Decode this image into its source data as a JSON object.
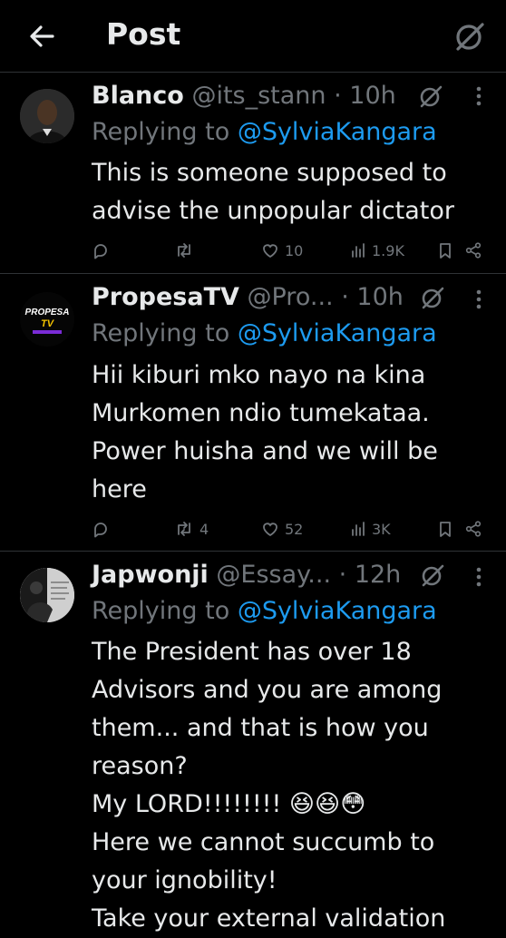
{
  "header": {
    "title": "Post",
    "back_icon": "arrow-left-icon",
    "grok_icon": "grok-icon"
  },
  "colors": {
    "background": "#000000",
    "text": "#e7e9ea",
    "muted": "#71767b",
    "link": "#1d9bf0",
    "divider": "#2f3336"
  },
  "posts": [
    {
      "name": "Blanco",
      "handle": "@its_stann",
      "separator": "·",
      "time": "10h",
      "replying_prefix": "Replying to",
      "replying_to": "@SylviaKangara",
      "text": "This is someone supposed to advise the unpopular dictator",
      "actions": {
        "replies": "",
        "reposts": "",
        "likes": "10",
        "views": "1.9K"
      }
    },
    {
      "name": "PropesaTV",
      "handle": "@Pro...",
      "separator": "·",
      "time": "10h",
      "replying_prefix": "Replying to",
      "replying_to": "@SylviaKangara",
      "avatar_text": "PROPESA TV",
      "text": "Hii kiburi mko nayo na kina\nMurkomen ndio tumekataa.\nPower huisha and we will be\nhere",
      "actions": {
        "replies": "",
        "reposts": "4",
        "likes": "52",
        "views": "3K"
      }
    },
    {
      "name": "Japwonji",
      "handle": "@Essay...",
      "separator": "·",
      "time": "12h",
      "replying_prefix": "Replying to",
      "replying_to": "@SylviaKangara",
      "text": "The President has over 18\nAdvisors and you are among\nthem... and that is how you\nreason?\nMy LORD!!!!!!!! 😆😆😳\nHere we cannot succumb to\nyour ignobility!\nTake your external validation"
    }
  ]
}
